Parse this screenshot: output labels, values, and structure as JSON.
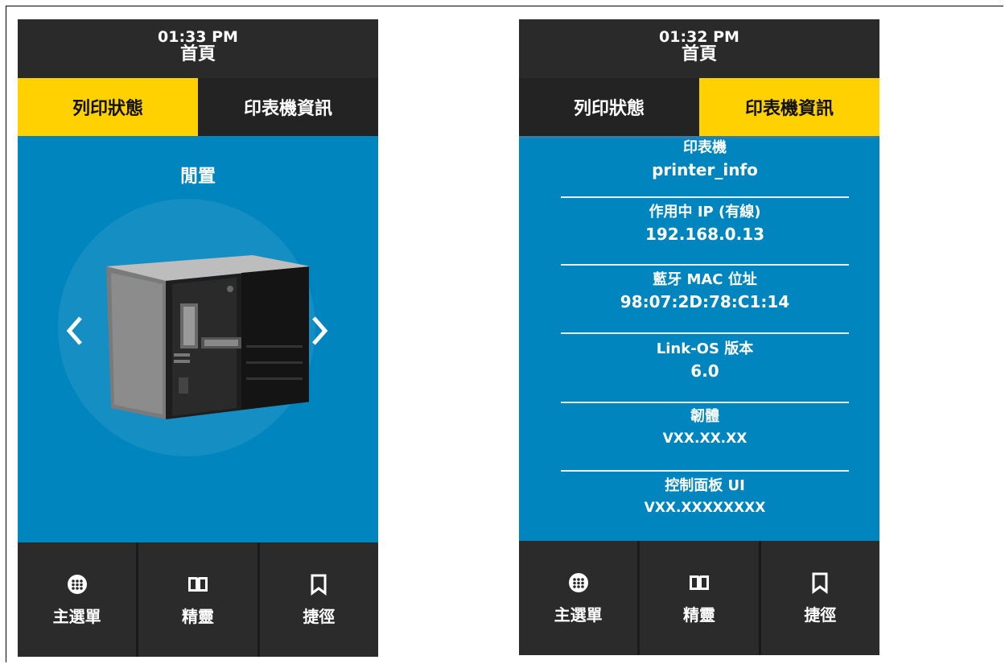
{
  "left": {
    "header": {
      "time": "01:33 PM",
      "title": "首頁"
    },
    "tabs": [
      {
        "label": "列印狀態",
        "active": true
      },
      {
        "label": "印表機資訊",
        "active": false
      }
    ],
    "status": "閒置",
    "footer": [
      {
        "label": "主選單",
        "icon": "globe-icon"
      },
      {
        "label": "精靈",
        "icon": "book-icon"
      },
      {
        "label": "捷徑",
        "icon": "bookmark-icon"
      }
    ]
  },
  "right": {
    "header": {
      "time": "01:32 PM",
      "title": "首頁"
    },
    "tabs": [
      {
        "label": "列印狀態",
        "active": false
      },
      {
        "label": "印表機資訊",
        "active": true
      }
    ],
    "info": [
      {
        "label": "印表機",
        "value": "printer_info"
      },
      {
        "label": "作用中 IP (有線)",
        "value": "192.168.0.13"
      },
      {
        "label": "藍牙 MAC 位址",
        "value": "98:07:2D:78:C1:14"
      },
      {
        "label": "Link-OS 版本",
        "value": "6.0"
      },
      {
        "label": "韌體",
        "value": "VXX.XX.XX"
      },
      {
        "label": "控制面板 UI",
        "value": "VXX.XXXXXXXX"
      }
    ],
    "footer": [
      {
        "label": "主選單",
        "icon": "globe-icon"
      },
      {
        "label": "精靈",
        "icon": "book-icon"
      },
      {
        "label": "捷徑",
        "icon": "bookmark-icon"
      }
    ]
  },
  "colors": {
    "header": "#2a2a2a",
    "tab_active": "#ffd100",
    "content": "#0085be",
    "footer": "#2b2b2b"
  }
}
